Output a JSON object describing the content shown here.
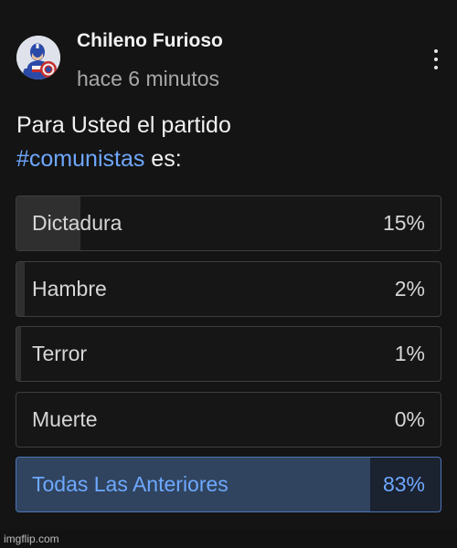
{
  "post": {
    "author": "Chileno Furioso",
    "timestamp": "hace 6 minutos",
    "question_text": "Para Usted el partido",
    "hashtag": "#comunistas",
    "question_suffix": " es:"
  },
  "poll": {
    "options": [
      {
        "label": "Dictadura",
        "percent_text": "15%",
        "percent": 15,
        "selected": false
      },
      {
        "label": "Hambre",
        "percent_text": "2%",
        "percent": 2,
        "selected": false
      },
      {
        "label": "Terror",
        "percent_text": "1%",
        "percent": 1,
        "selected": false
      },
      {
        "label": "Muerte",
        "percent_text": "0%",
        "percent": 0,
        "selected": false
      },
      {
        "label": "Todas Las Anteriores",
        "percent_text": "83%",
        "percent": 83,
        "selected": true
      }
    ]
  },
  "watermark": "imgflip.com",
  "colors": {
    "accent": "#6ea8ff",
    "background": "#141414"
  },
  "icons": {
    "avatar": "captain-america-avatar",
    "more": "more-vertical-icon"
  }
}
